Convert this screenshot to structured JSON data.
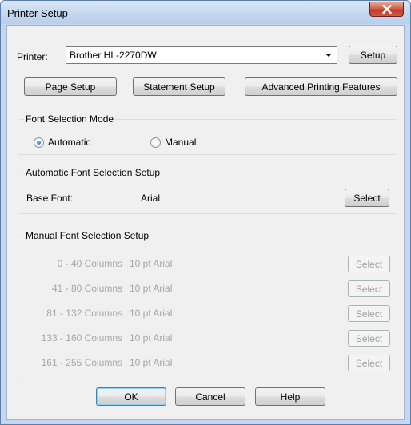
{
  "window": {
    "title": "Printer Setup",
    "close_icon": "close-icon"
  },
  "printer": {
    "label": "Printer:",
    "selected": "Brother HL-2270DW",
    "setup_label": "Setup"
  },
  "toolbar": {
    "page_setup": "Page Setup",
    "statement_setup": "Statement Setup",
    "advanced": "Advanced Printing Features"
  },
  "font_mode": {
    "title": "Font Selection Mode",
    "automatic": "Automatic",
    "manual": "Manual",
    "selected": "automatic"
  },
  "auto_font": {
    "title": "Automatic Font Selection Setup",
    "base_label": "Base Font:",
    "base_value": "Arial",
    "select_label": "Select"
  },
  "manual_font": {
    "title": "Manual Font Selection Setup",
    "rows": [
      {
        "range": "0 - 40 Columns",
        "font": "10 pt Arial",
        "select": "Select"
      },
      {
        "range": "41 - 80 Columns",
        "font": "10 pt Arial",
        "select": "Select"
      },
      {
        "range": "81 - 132 Columns",
        "font": "10 pt Arial",
        "select": "Select"
      },
      {
        "range": "133 - 160 Columns",
        "font": "10 pt Arial",
        "select": "Select"
      },
      {
        "range": "161 - 255 Columns",
        "font": "10 pt Arial",
        "select": "Select"
      }
    ]
  },
  "footer": {
    "ok": "OK",
    "cancel": "Cancel",
    "help": "Help"
  }
}
